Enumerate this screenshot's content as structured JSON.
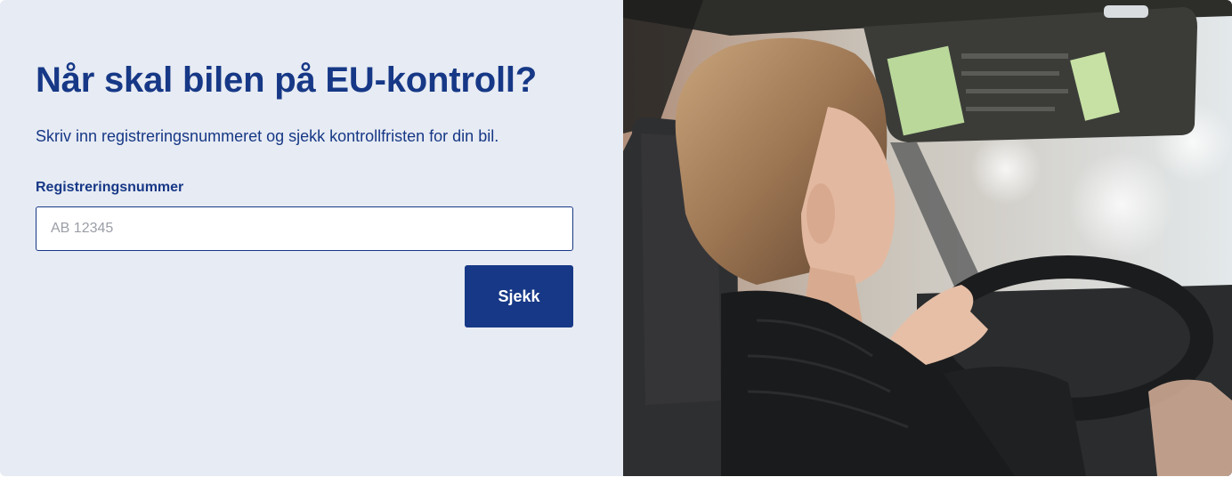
{
  "form": {
    "title": "Når skal bilen på EU-kontroll?",
    "subtitle": "Skriv inn registreringsnummeret og sjekk kontrollfristen for din bil.",
    "field_label": "Registreringsnummer",
    "input_placeholder": "AB 12345",
    "input_value": "",
    "submit_label": "Sjekk"
  },
  "colors": {
    "brand": "#163886",
    "panel_bg": "#e7ebf3"
  },
  "photo": {
    "subject": "woman-driving-car-photo"
  }
}
